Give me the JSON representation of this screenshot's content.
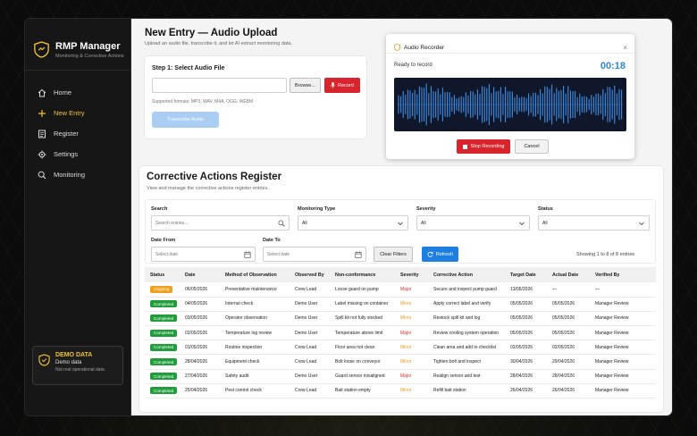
{
  "app": {
    "title": "RMP Manager",
    "subtitle": "Monitoring & Corrective Actions"
  },
  "sidebar": {
    "items": [
      {
        "label": "Home",
        "icon": "home-icon",
        "active": false
      },
      {
        "label": "New Entry",
        "icon": "plus-icon",
        "active": true
      },
      {
        "label": "Register",
        "icon": "register-icon",
        "active": false
      },
      {
        "label": "Settings",
        "icon": "gear-icon",
        "active": false
      },
      {
        "label": "Monitoring",
        "icon": "search-icon",
        "active": false
      }
    ],
    "demo": {
      "title": "DEMO DATA",
      "line1": "Demo data",
      "line2": "Not real operational data"
    }
  },
  "page": {
    "title": "New Entry — Audio Upload",
    "subtitle": "Upload an audio file, transcribe it, and let AI extract monitoring data."
  },
  "upload": {
    "step_title": "Step 1: Select Audio File",
    "file_value": "",
    "browse_label": "Browse...",
    "record_label": "Record",
    "formats": "Supported formats: MP3, WAV, M4A, OGG, WEBM",
    "transcribe_label": "Transcribe Audio"
  },
  "recorder": {
    "title": "Audio Recorder",
    "status": "Ready to record",
    "timer": "00:18",
    "stop_label": "Stop Recording",
    "cancel_label": "Cancel",
    "close_glyph": "×"
  },
  "register": {
    "title": "Corrective Actions Register",
    "subtitle": "View and manage the corrective actions register entries.",
    "filters": {
      "search_label": "Search",
      "search_placeholder": "Search entries...",
      "monitoring_label": "Monitoring Type",
      "monitoring_value": "All",
      "severity_label": "Severity",
      "severity_value": "All",
      "status_label": "Status",
      "status_value": "All",
      "date_from_label": "Date From",
      "date_from_placeholder": "Select date",
      "date_to_label": "Date To",
      "date_to_placeholder": "Select date",
      "clear_label": "Clear Filters",
      "refresh_label": "Refresh",
      "showing": "Showing 1 to 8 of 8 entries"
    },
    "columns": [
      "Status",
      "Date",
      "Method of Observation",
      "Observed By",
      "Non-conformance",
      "Severity",
      "Corrective Action",
      "Target Date",
      "Actual Date",
      "Verified By"
    ],
    "rows": [
      {
        "status": "Ongoing",
        "date": "06/05/2026",
        "method": "Preventative maintenance",
        "observed_by": "Crew Lead",
        "nonconformance": "Loose guard on pump",
        "severity": "Major",
        "action": "Secure and inspect pump guard",
        "target": "13/05/2026",
        "actual": "—",
        "verified": "—"
      },
      {
        "status": "Completed",
        "date": "04/05/2026",
        "method": "Internal check",
        "observed_by": "Demo User",
        "nonconformance": "Label missing on container",
        "severity": "Minor",
        "action": "Apply correct label and verify",
        "target": "05/05/2026",
        "actual": "05/05/2026",
        "verified": "Manager Review"
      },
      {
        "status": "Completed",
        "date": "03/05/2026",
        "method": "Operator observation",
        "observed_by": "Demo User",
        "nonconformance": "Spill kit not fully stocked",
        "severity": "Minor",
        "action": "Restock spill kit and log",
        "target": "05/05/2026",
        "actual": "05/05/2026",
        "verified": "Manager Review"
      },
      {
        "status": "Completed",
        "date": "02/05/2026",
        "method": "Temperature log review",
        "observed_by": "Demo User",
        "nonconformance": "Temperature above limit",
        "severity": "Major",
        "action": "Review cooling system operation",
        "target": "05/05/2026",
        "actual": "05/05/2026",
        "verified": "Manager Review"
      },
      {
        "status": "Completed",
        "date": "01/05/2026",
        "method": "Routine inspection",
        "observed_by": "Crew Lead",
        "nonconformance": "Floor area not clean",
        "severity": "Minor",
        "action": "Clean area and add to checklist",
        "target": "02/05/2026",
        "actual": "02/05/2026",
        "verified": "Manager Review"
      },
      {
        "status": "Completed",
        "date": "28/04/2026",
        "method": "Equipment check",
        "observed_by": "Crew Lead",
        "nonconformance": "Bolt loose on conveyor",
        "severity": "Minor",
        "action": "Tighten bolt and inspect",
        "target": "30/04/2026",
        "actual": "29/04/2026",
        "verified": "Manager Review"
      },
      {
        "status": "Completed",
        "date": "27/04/2026",
        "method": "Safety audit",
        "observed_by": "Demo User",
        "nonconformance": "Guard sensor misaligned",
        "severity": "Major",
        "action": "Realign sensor and test",
        "target": "28/04/2026",
        "actual": "28/04/2026",
        "verified": "Manager Review"
      },
      {
        "status": "Completed",
        "date": "25/04/2026",
        "method": "Pest control check",
        "observed_by": "Crew Lead",
        "nonconformance": "Bait station empty",
        "severity": "Minor",
        "action": "Refill bait station",
        "target": "26/04/2026",
        "actual": "26/04/2026",
        "verified": "Manager Review"
      }
    ]
  },
  "colors": {
    "accent": "#f1c232",
    "danger": "#d7242d",
    "primary": "#1e7fe0",
    "ongoing": "#f0a01e",
    "completed": "#1f9d3a",
    "major": "#d32f2f",
    "minor": "#e69a1a",
    "timer": "#2b88d8"
  }
}
